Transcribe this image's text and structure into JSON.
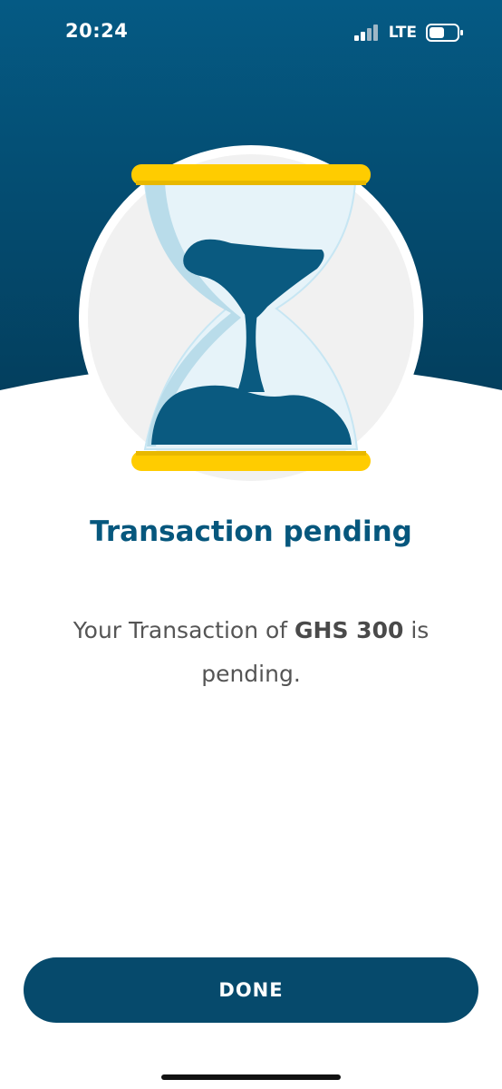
{
  "status_bar": {
    "time": "20:24",
    "network": "LTE",
    "icons": [
      "signal-icon",
      "battery-icon"
    ]
  },
  "illustration": {
    "icon": "hourglass-icon"
  },
  "title": "Transaction pending",
  "message": {
    "prefix": "Your Transaction of ",
    "amount": "GHS 300",
    "suffix": " is pending."
  },
  "done_button": {
    "label": "DONE"
  },
  "colors": {
    "header_bg": "#044a6c",
    "title": "#06577d",
    "button_bg": "#064a6c",
    "hourglass_caps": "#ffcc00",
    "hourglass_sand": "#0a5a80"
  }
}
